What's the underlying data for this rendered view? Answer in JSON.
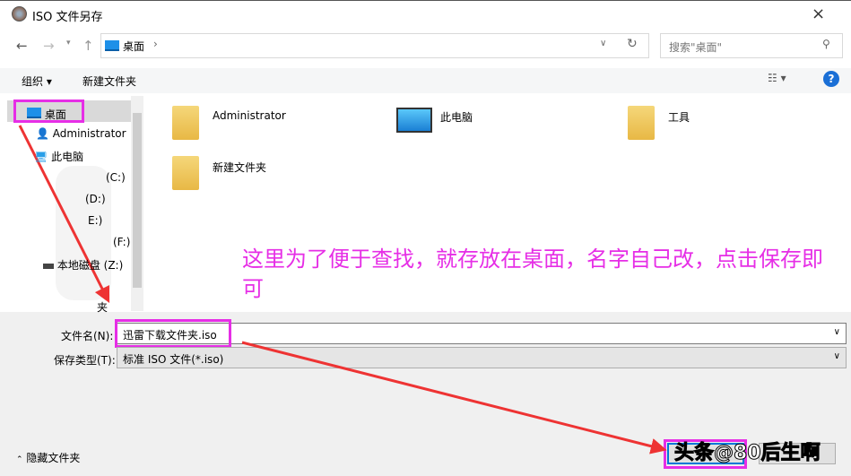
{
  "window": {
    "title": "ISO 文件另存",
    "close_icon": "×"
  },
  "navbar": {
    "breadcrumb": "桌面",
    "search_placeholder": "搜索\"桌面\""
  },
  "toolbar": {
    "organize": "组织",
    "new_folder": "新建文件夹",
    "help": "?"
  },
  "sidebar": {
    "items": [
      {
        "label": "桌面"
      },
      {
        "label": "Administrator"
      },
      {
        "label": "此电脑"
      },
      {
        "label": "(C:)"
      },
      {
        "label": "(D:)"
      },
      {
        "label": "E:)"
      },
      {
        "label": "(F:)"
      },
      {
        "label": "本地磁盘 (Z:)"
      },
      {
        "label": "夹"
      }
    ]
  },
  "content": {
    "items": [
      {
        "label": "Administrator"
      },
      {
        "label": "此电脑"
      },
      {
        "label": "工具"
      },
      {
        "label": "新建文件夹"
      }
    ]
  },
  "form": {
    "filename_label": "文件名(N):",
    "filename_value": "迅雷下载文件夹.iso",
    "type_label": "保存类型(T):",
    "type_value": "标准 ISO 文件(*.iso)"
  },
  "footer": {
    "hide_folders": "隐藏文件夹"
  },
  "annotation": "这里为了便于查找，就存放在桌面，名字自己改，点击保存即可",
  "watermark": "头条@80后生啊",
  "colors": {
    "highlight": "#e62ee6",
    "arrow": "#ee3333"
  }
}
